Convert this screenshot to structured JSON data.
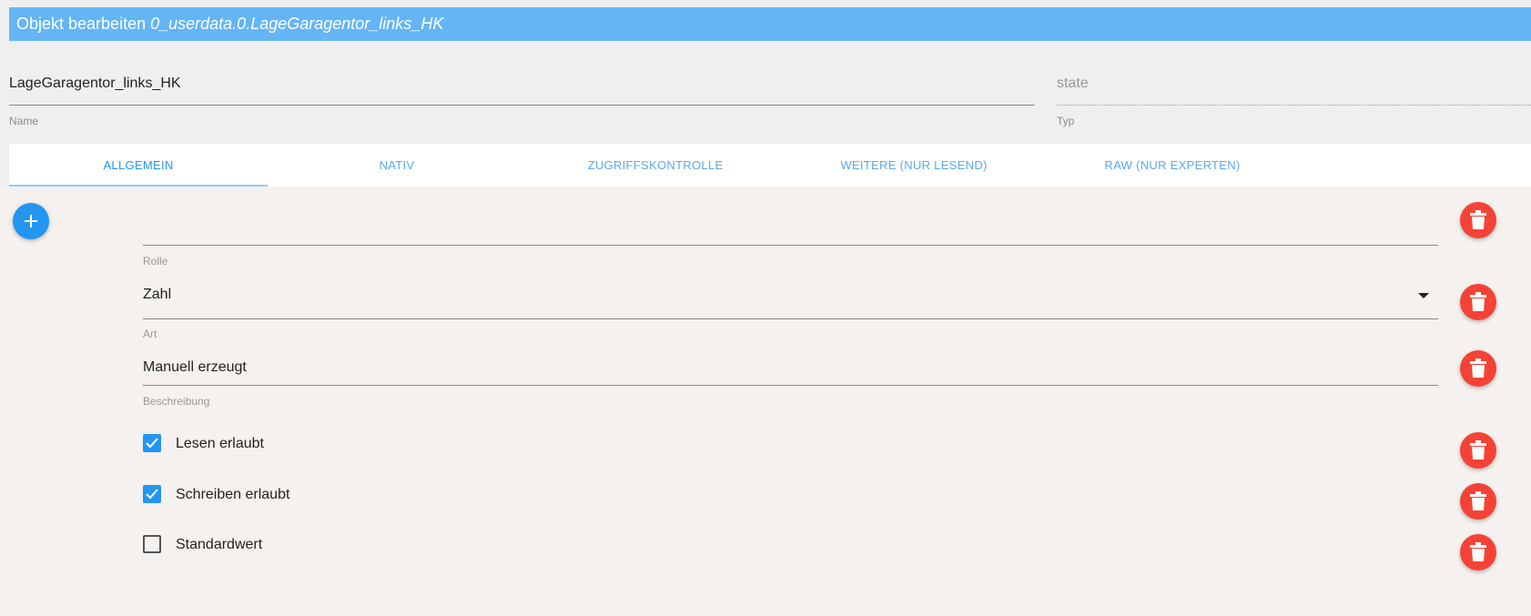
{
  "dialog": {
    "title_prefix": "Objekt bearbeiten",
    "object_id": "0_userdata.0.LageGaragentor_links_HK"
  },
  "fields": {
    "name": {
      "value": "LageGaragentor_links_HK",
      "label": "Name"
    },
    "type": {
      "value": "state",
      "label": "Typ"
    }
  },
  "tabs": [
    {
      "label": "ALLGEMEIN",
      "active": true
    },
    {
      "label": "NATIV"
    },
    {
      "label": "ZUGRIFFSKONTROLLE"
    },
    {
      "label": "WEITERE (NUR LESEND)"
    },
    {
      "label": "RAW (NUR EXPERTEN)"
    }
  ],
  "general": {
    "role": {
      "value": "",
      "label": "Rolle"
    },
    "art": {
      "value": "Zahl",
      "label": "Art"
    },
    "description": {
      "value": "Manuell erzeugt",
      "label": "Beschreibung"
    },
    "read": {
      "label": "Lesen erlaubt",
      "checked": true
    },
    "write": {
      "label": "Schreiben erlaubt",
      "checked": true
    },
    "default": {
      "label": "Standardwert",
      "checked": false
    }
  },
  "colors": {
    "accent": "#2196f3",
    "title_bar": "#64b5f6",
    "delete": "#f44336"
  },
  "icons": {
    "add": "plus-icon",
    "delete": "trash-icon",
    "dropdown": "caret-down-icon",
    "check": "check-icon"
  }
}
